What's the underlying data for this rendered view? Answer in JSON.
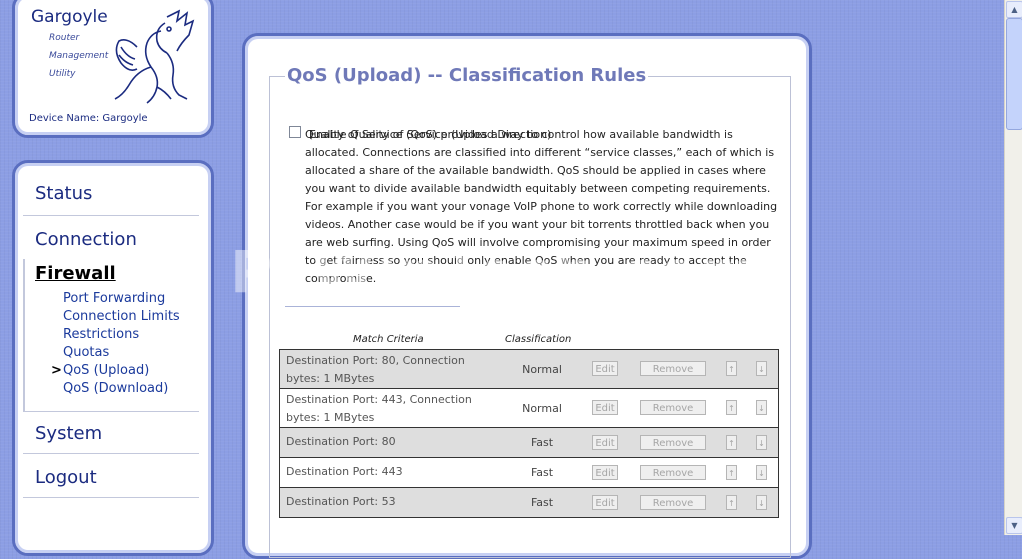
{
  "logo": {
    "title": "Gargoyle",
    "subtitle_lines": [
      "Router",
      "Management",
      "Utility"
    ],
    "device_name": "Device Name: Gargoyle"
  },
  "nav": {
    "items": [
      {
        "label": "Status"
      },
      {
        "label": "Connection"
      },
      {
        "label": "Firewall"
      },
      {
        "label": "System"
      },
      {
        "label": "Logout"
      }
    ],
    "firewall_sub": [
      {
        "label": "Port Forwarding"
      },
      {
        "label": "Connection Limits"
      },
      {
        "label": "Restrictions"
      },
      {
        "label": "Quotas"
      },
      {
        "label": "QoS (Upload)"
      },
      {
        "label": "QoS (Download)"
      }
    ],
    "current_marker": ">"
  },
  "main": {
    "section_title": "QoS (Upload) -- Classification Rules",
    "enable_label": "Enable Quality of Service (Upload Direction)",
    "enable_checked": false,
    "description": "Quality of Service (QoS) provides a way to control how available bandwidth is allocated. Connections are classified into different “service classes,” each of which is allocated a share of the available bandwidth. QoS should be applied in cases where you want to divide available bandwidth equitably between competing requirements. For example if you want your vonage VoIP phone to work correctly while downloading videos. Another case would be if you want your bit torrents throttled back when you are web surfing. Using QoS will involve compromising your maximum speed in order to get fairness so you should only enable QoS when you are ready to accept the compromise.",
    "table": {
      "headers": {
        "match": "Match Criteria",
        "classification": "Classification"
      },
      "buttons": {
        "edit": "Edit",
        "remove": "Remove",
        "up": "↑",
        "down": "↓"
      },
      "rows": [
        {
          "criteria": "Destination Port: 80, Connection bytes: 1 MBytes",
          "classification": "Normal"
        },
        {
          "criteria": "Destination Port: 443, Connection bytes: 1 MBytes",
          "classification": "Normal"
        },
        {
          "criteria": "Destination Port: 80",
          "classification": "Fast"
        },
        {
          "criteria": "Destination Port: 443",
          "classification": "Fast"
        },
        {
          "criteria": "Destination Port: 53",
          "classification": "Fast"
        }
      ]
    }
  },
  "watermark": "PcWinTech.com",
  "colors": {
    "background": "#8c9ee4",
    "panel_border": "#5a6ec0",
    "title_color": "#6f79b8",
    "nav_text": "#1b2b80"
  }
}
